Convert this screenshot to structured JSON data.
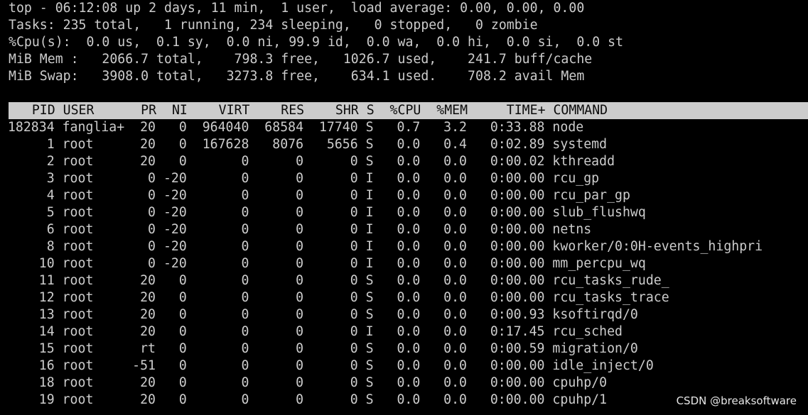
{
  "summary": {
    "line1": "top - 06:12:08 up 2 days, 11 min,  1 user,  load average: 0.00, 0.00, 0.00",
    "line2": "Tasks: 235 total,   1 running, 234 sleeping,   0 stopped,   0 zombie",
    "line3": "%Cpu(s):  0.0 us,  0.1 sy,  0.0 ni, 99.9 id,  0.0 wa,  0.0 hi,  0.0 si,  0.0 st",
    "line4": "MiB Mem :   2066.7 total,    798.3 free,   1026.7 used,    241.7 buff/cache",
    "line5": "MiB Swap:   3908.0 total,   3273.8 free,    634.1 used.    708.2 avail Mem"
  },
  "header": "   PID USER      PR  NI    VIRT    RES    SHR S  %CPU  %MEM     TIME+ COMMAND",
  "rows": [
    " 182834 fanglia+  20   0  964040  68584  17740 S   0.7   3.2   0:33.88 node",
    "      1 root      20   0  167628   8076   5656 S   0.0   0.4   0:02.89 systemd",
    "      2 root      20   0       0      0      0 S   0.0   0.0   0:00.02 kthreadd",
    "      3 root       0 -20       0      0      0 I   0.0   0.0   0:00.00 rcu_gp",
    "      4 root       0 -20       0      0      0 I   0.0   0.0   0:00.00 rcu_par_gp",
    "      5 root       0 -20       0      0      0 I   0.0   0.0   0:00.00 slub_flushwq",
    "      6 root       0 -20       0      0      0 I   0.0   0.0   0:00.00 netns",
    "      8 root       0 -20       0      0      0 I   0.0   0.0   0:00.00 kworker/0:0H-events_highpri",
    "     10 root       0 -20       0      0      0 I   0.0   0.0   0:00.00 mm_percpu_wq",
    "     11 root      20   0       0      0      0 S   0.0   0.0   0:00.00 rcu_tasks_rude_",
    "     12 root      20   0       0      0      0 S   0.0   0.0   0:00.00 rcu_tasks_trace",
    "     13 root      20   0       0      0      0 S   0.0   0.0   0:00.93 ksoftirqd/0",
    "     14 root      20   0       0      0      0 I   0.0   0.0   0:17.45 rcu_sched",
    "     15 root      rt   0       0      0      0 S   0.0   0.0   0:00.59 migration/0",
    "     16 root     -51   0       0      0      0 S   0.0   0.0   0:00.00 idle_inject/0",
    "     18 root      20   0       0      0      0 S   0.0   0.0   0:00.00 cpuhp/0",
    "     19 root      20   0       0      0      0 S   0.0   0.0   0:00.00 cpuhp/1"
  ],
  "watermark": "CSDN @breaksoftware",
  "colors": {
    "background": "#000000",
    "text": "#cccccc",
    "header_bg": "#cccccc",
    "header_text": "#0c0c0c"
  }
}
